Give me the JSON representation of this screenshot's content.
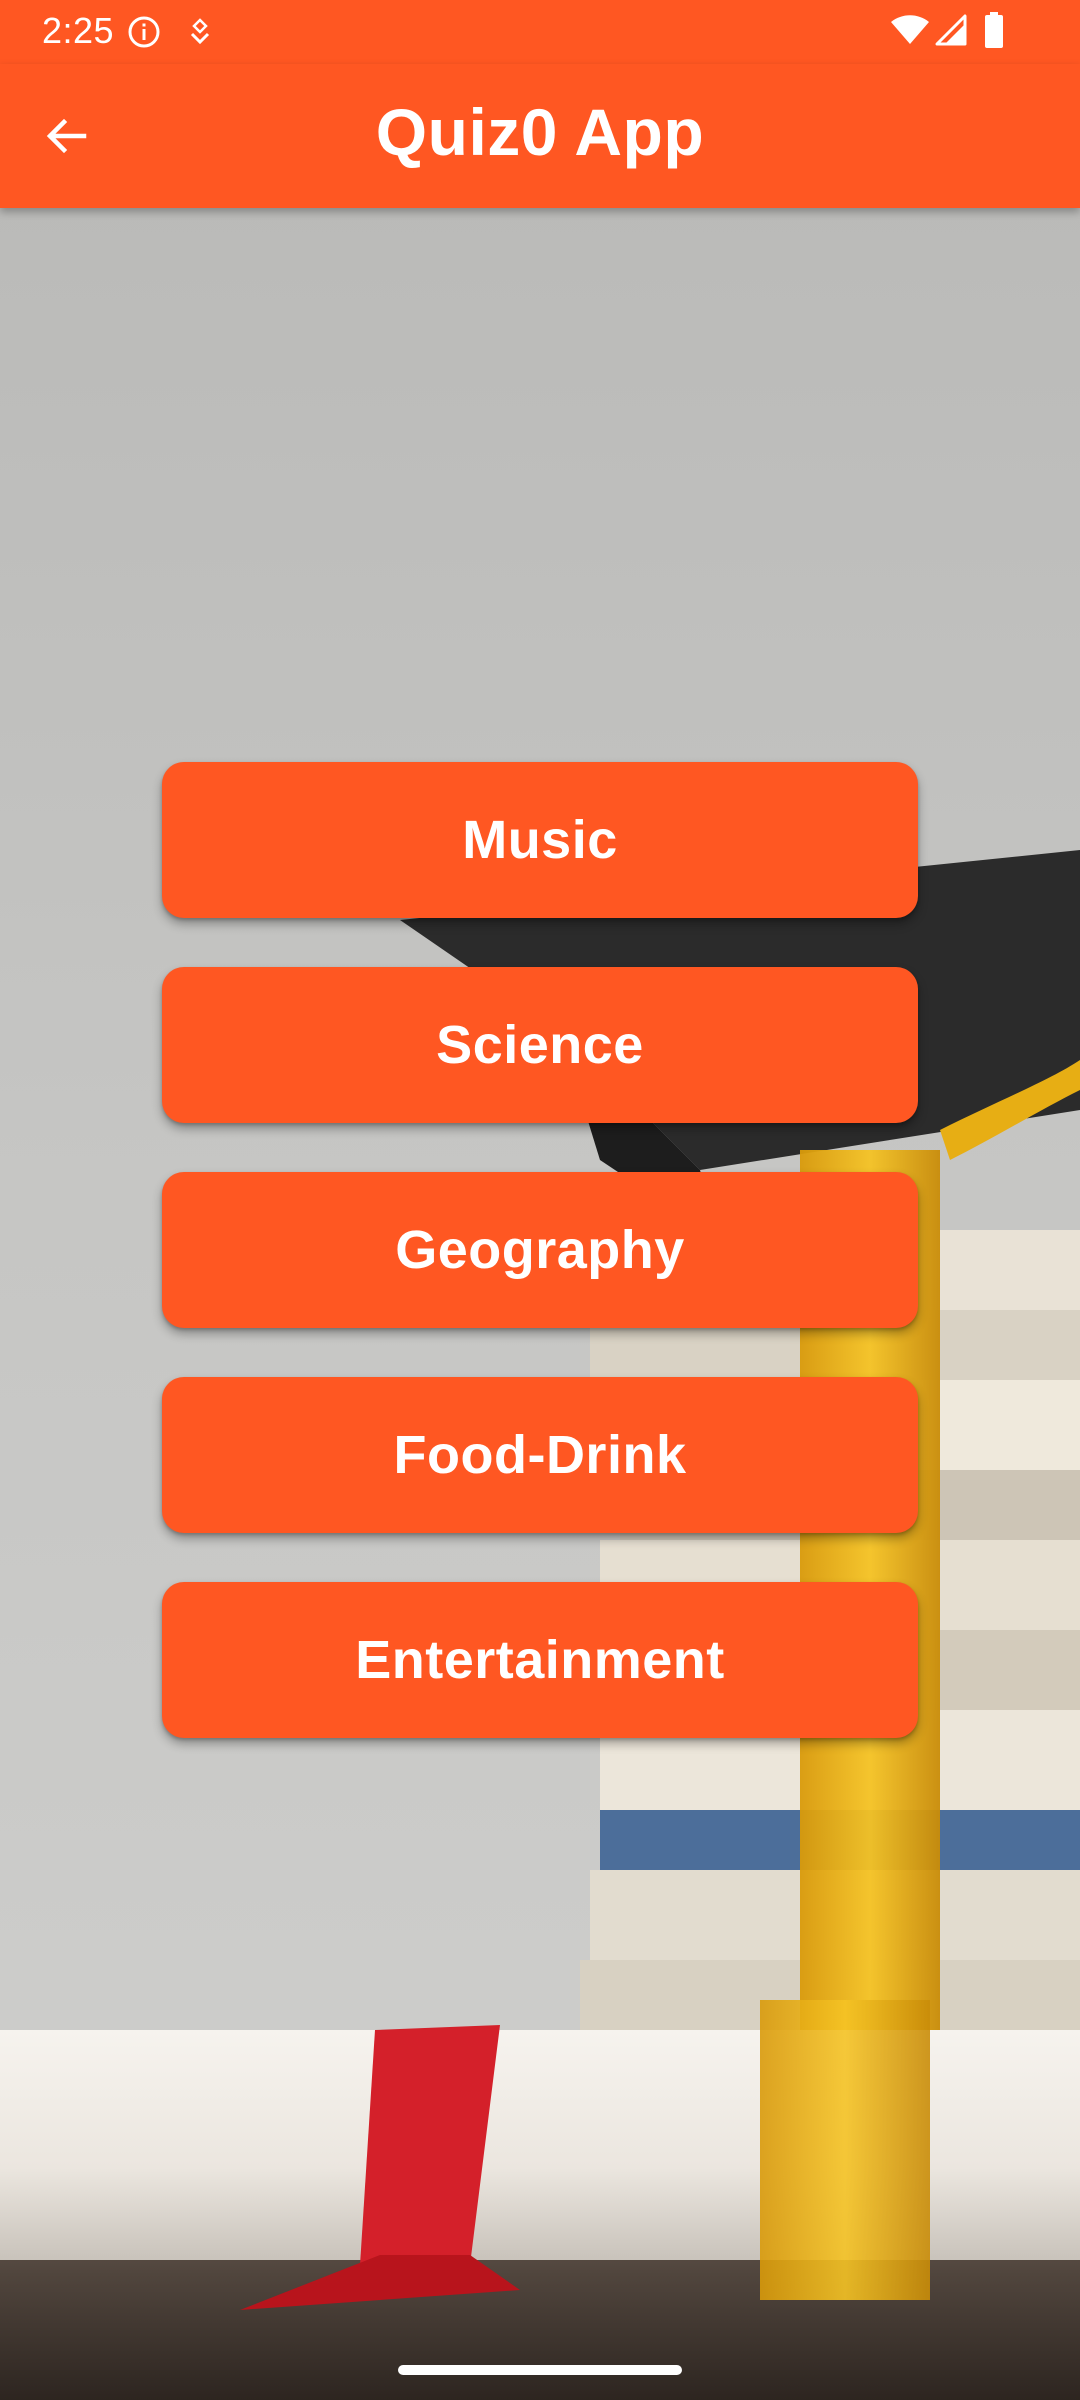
{
  "status_bar": {
    "time": "2:25",
    "icons": [
      "info-icon",
      "app-notification-icon",
      "wifi-icon",
      "cellular-signal-icon",
      "battery-icon"
    ]
  },
  "app_bar": {
    "title": "Quiz0 App",
    "back_icon": "arrow-back-icon"
  },
  "categories": [
    {
      "label": "Music"
    },
    {
      "label": "Science"
    },
    {
      "label": "Geography"
    },
    {
      "label": "Food-Drink"
    },
    {
      "label": "Entertainment"
    }
  ],
  "theme": {
    "accent": "#ff5722",
    "on_accent": "#ffffff"
  },
  "background_image": "graduation cap, tassel, books and diploma photo"
}
